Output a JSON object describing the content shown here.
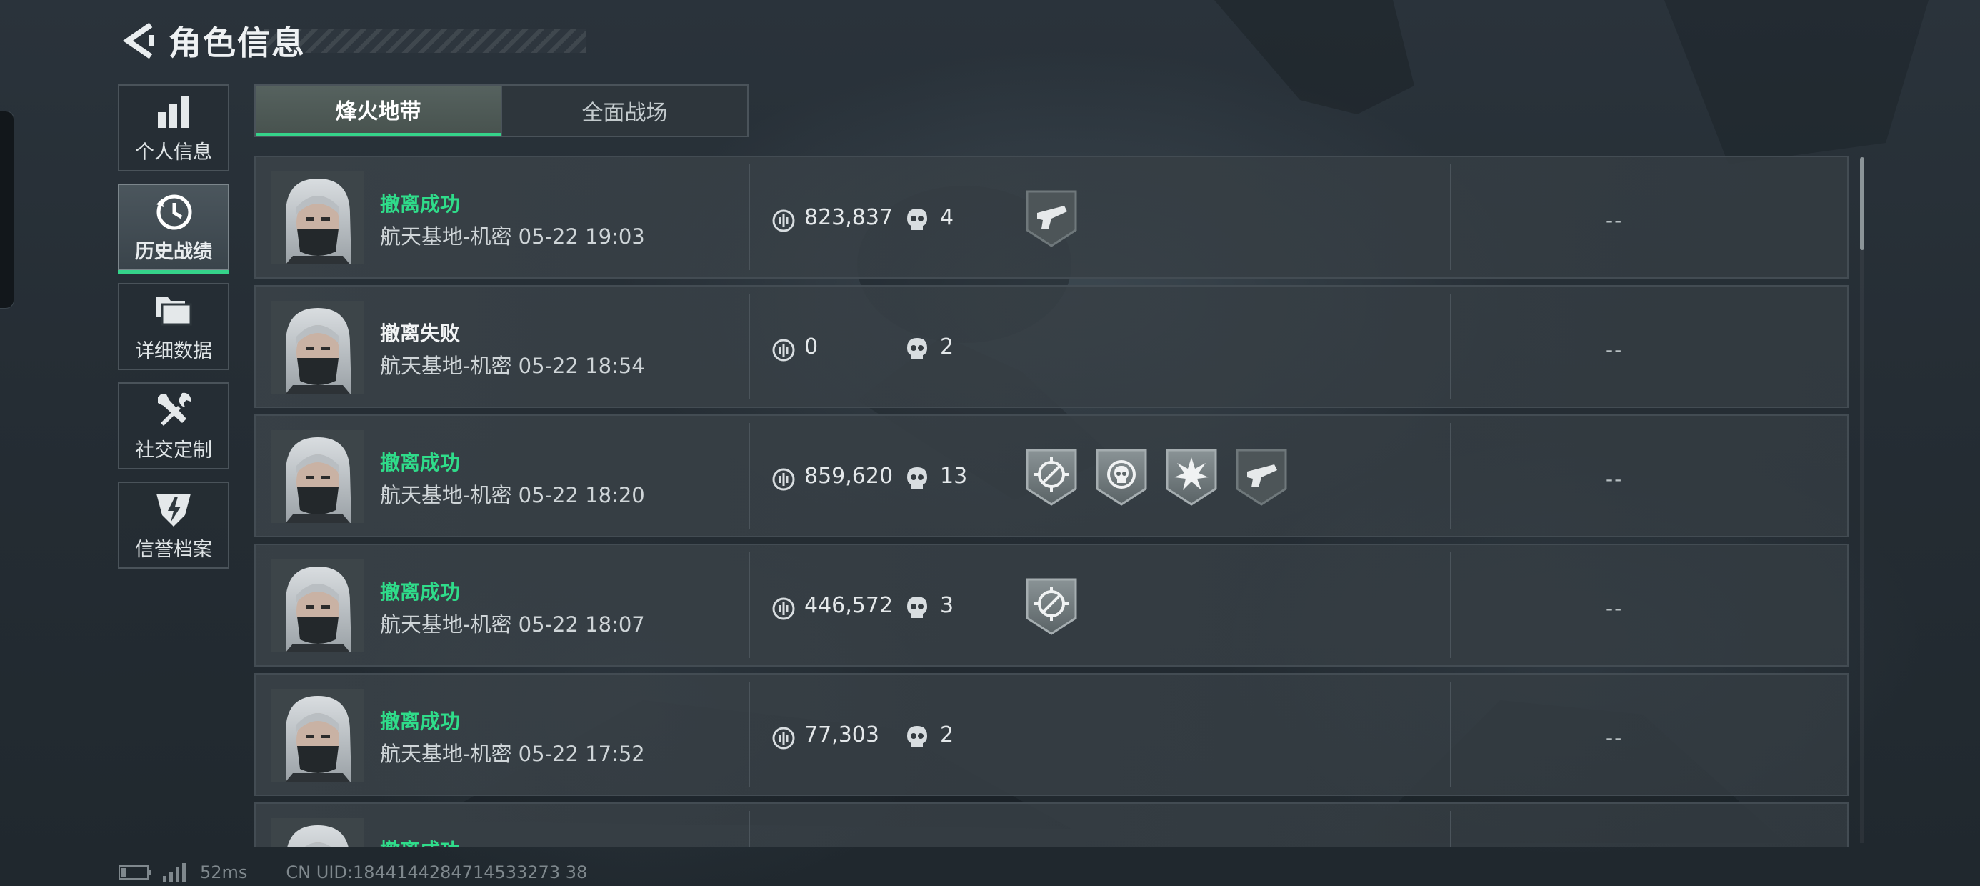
{
  "header": {
    "title": "角色信息"
  },
  "sidebar": {
    "items": [
      {
        "label": "个人信息",
        "icon": "bar-chart-icon",
        "active": false
      },
      {
        "label": "历史战绩",
        "icon": "history-clock-icon",
        "active": true
      },
      {
        "label": "详细数据",
        "icon": "folders-icon",
        "active": false
      },
      {
        "label": "社交定制",
        "icon": "tools-icon",
        "active": false
      },
      {
        "label": "信誉档案",
        "icon": "shield-bolt-icon",
        "active": false
      }
    ]
  },
  "tabs": [
    {
      "label": "烽火地带",
      "active": true
    },
    {
      "label": "全面战场",
      "active": false
    }
  ],
  "records": [
    {
      "status": "撤离成功",
      "result": "win",
      "map_time": "航天基地-机密 05-22 19:03",
      "money": "823,837",
      "kills": "4",
      "badges": [
        "handgun-badge-icon"
      ],
      "extra": "--"
    },
    {
      "status": "撤离失败",
      "result": "fail",
      "map_time": "航天基地-机密 05-22 18:54",
      "money": "0",
      "kills": "2",
      "badges": [],
      "extra": "--"
    },
    {
      "status": "撤离成功",
      "result": "win",
      "map_time": "航天基地-机密 05-22 18:20",
      "money": "859,620",
      "kills": "13",
      "badges": [
        "crosshair-badge-icon",
        "skull-target-badge-icon",
        "explosion-badge-icon",
        "handgun-badge-icon"
      ],
      "extra": "--"
    },
    {
      "status": "撤离成功",
      "result": "win",
      "map_time": "航天基地-机密 05-22 18:07",
      "money": "446,572",
      "kills": "3",
      "badges": [
        "crosshair-badge-icon"
      ],
      "extra": "--"
    },
    {
      "status": "撤离成功",
      "result": "win",
      "map_time": "航天基地-机密 05-22 17:52",
      "money": "77,303",
      "kills": "2",
      "badges": [],
      "extra": "--"
    },
    {
      "status": "撤离成功",
      "result": "win",
      "map_time": "",
      "money": "",
      "kills": "",
      "badges": [],
      "extra": ""
    }
  ],
  "footer": {
    "ping": "52ms",
    "uid": "CN UID:1844144284714533273 38"
  },
  "colors": {
    "accent": "#35d38a",
    "success_text": "#2fdc8a",
    "panel": "#3a4248"
  }
}
